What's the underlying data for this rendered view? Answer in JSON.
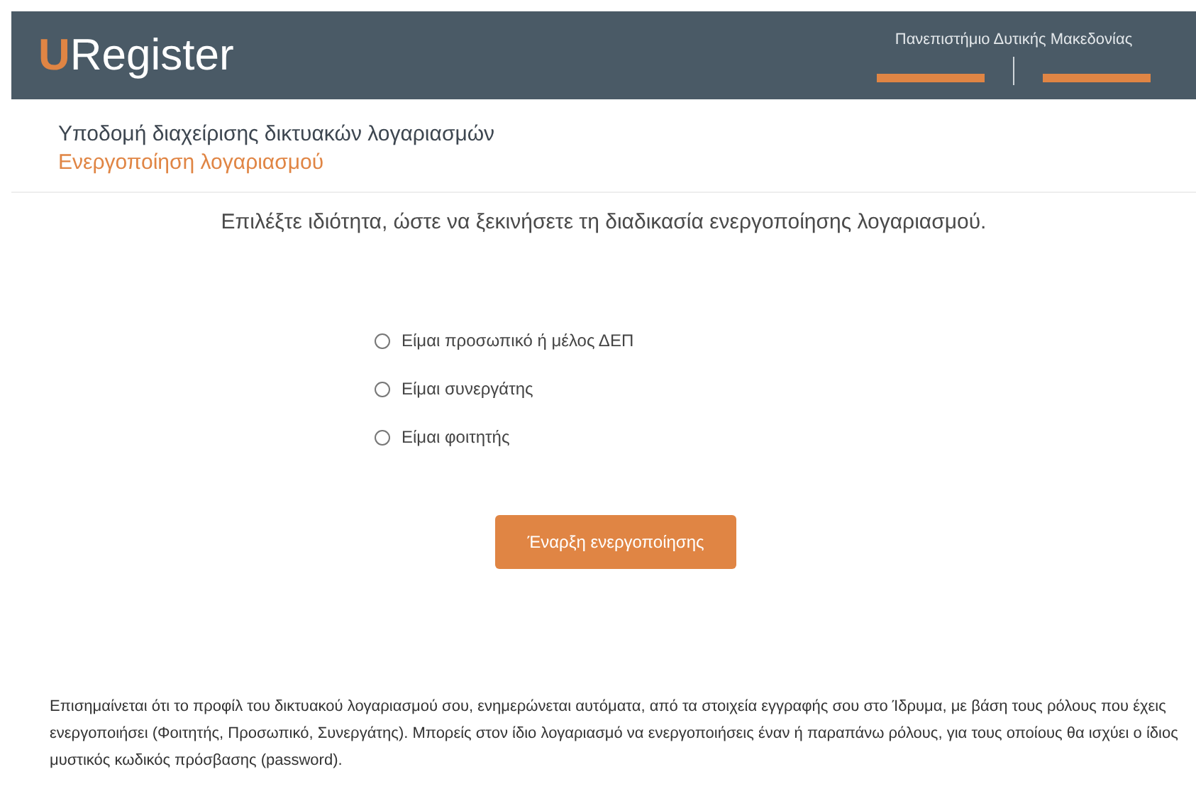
{
  "header": {
    "logo_initial": "U",
    "logo_rest": "Register",
    "institution": "Πανεπιστήμιο Δυτικής Μακεδονίας"
  },
  "page": {
    "title": "Υποδομή διαχείρισης δικτυακών λογαριασμών",
    "subtitle": "Ενεργοποίηση λογαριασμού"
  },
  "prompt": "Επιλέξτε ιδιότητα, ώστε να ξεκινήσετε τη διαδικασία ενεργοποίησης λογαριασμού.",
  "options": [
    {
      "label": "Είμαι προσωπικό ή μέλος ΔΕΠ",
      "selected": false
    },
    {
      "label": "Είμαι συνεργάτης",
      "selected": false
    },
    {
      "label": "Είμαι φοιτητής",
      "selected": false
    }
  ],
  "submit_button": "Έναρξη ενεργοποίησης",
  "note": "Επισημαίνεται ότι το προφίλ του δικτυακού λογαριασμού σου, ενημερώνεται αυτόματα, από τα στοιχεία εγγραφής σου στο Ίδρυμα, με βάση τους ρόλους που έχεις ενεργοποιήσει (Φοιτητής, Προσωπικό, Συνεργάτης). Μπορείς στον ίδιο λογαριασμό να ενεργοποιήσεις έναν ή παραπάνω ρόλους, για τους οποίους θα ισχύει ο ίδιος μυστικός κωδικός πρόσβασης (password)."
}
